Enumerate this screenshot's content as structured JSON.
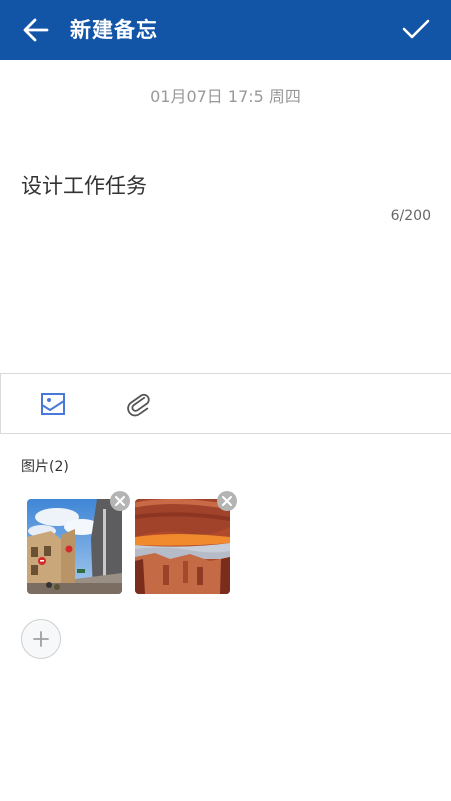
{
  "header": {
    "title": "新建备忘",
    "back_icon": "arrow-left-icon",
    "confirm_icon": "checkmark-icon",
    "background_color": "#1254a6"
  },
  "note": {
    "date": "01月07日 17:5 周四",
    "text": "设计工作任务",
    "counter": "6/200"
  },
  "toolbar": {
    "items": [
      {
        "icon": "image-icon",
        "color": "#4a78d8"
      },
      {
        "icon": "paperclip-icon",
        "color": "#555555"
      }
    ]
  },
  "images": {
    "label": "图片(2)",
    "thumbnails": [
      {
        "name": "street-photo"
      },
      {
        "name": "canyon-arch-photo"
      }
    ],
    "remove_icon": "close-icon",
    "add_icon": "plus-icon"
  }
}
